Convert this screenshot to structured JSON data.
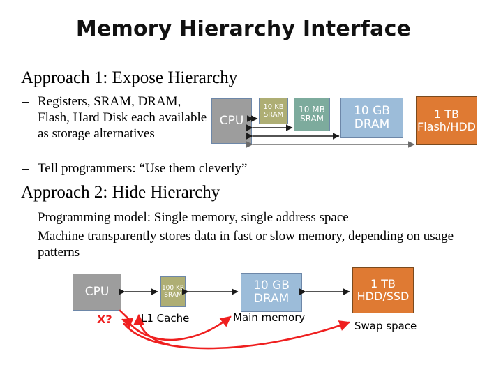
{
  "slide": {
    "title": "Memory Hierarchy Interface"
  },
  "approach1": {
    "heading": "Approach 1: Expose Hierarchy",
    "bullets": [
      {
        "dash": "–",
        "text": "Registers, SRAM, DRAM, Flash, Hard Disk each available as storage alternatives"
      },
      {
        "dash": "–",
        "text": "Tell programmers: “Use them cleverly”"
      }
    ],
    "diagram": {
      "boxes": [
        {
          "label": "CPU",
          "kind": "cpu"
        },
        {
          "label": "10 KB\nSRAM",
          "line1": "10 KB",
          "line2": "SRAM",
          "kind": "olive"
        },
        {
          "label": "10 MB\nSRAM",
          "line1": "10 MB",
          "line2": "SRAM",
          "kind": "teal"
        },
        {
          "label": "10 GB\nDRAM",
          "line1": "10 GB",
          "line2": "DRAM",
          "kind": "blue"
        },
        {
          "label": "1 TB\nFlash/HDD",
          "line1": "1 TB",
          "line2": "Flash/HDD",
          "kind": "orange"
        }
      ]
    }
  },
  "approach2": {
    "heading": "Approach 2: Hide Hierarchy",
    "bullets": [
      {
        "dash": "–",
        "text": "Programming model: Single memory, single address space"
      },
      {
        "dash": "–",
        "text": "Machine transparently stores data in fast or slow memory, depending on usage patterns"
      }
    ],
    "diagram": {
      "boxes": [
        {
          "label": "CPU",
          "kind": "cpu"
        },
        {
          "line1": "100 KB",
          "line2": "SRAM",
          "kind": "olive"
        },
        {
          "line1": "10 GB",
          "line2": "DRAM",
          "kind": "blue"
        },
        {
          "line1": "1 TB",
          "line2": "HDD/SSD",
          "kind": "orange"
        }
      ],
      "captions": [
        {
          "text": "L1 Cache"
        },
        {
          "text": "Main memory"
        },
        {
          "text": "Swap space"
        }
      ],
      "annotation": {
        "text": "X?",
        "color": "#ef1f1f"
      }
    }
  },
  "colors": {
    "cpu_fill": "#9d9d9d",
    "olive_fill": "#aeae74",
    "teal_fill": "#7dab9d",
    "blue_fill": "#9cbcd9",
    "orange_fill": "#df7a33",
    "box_border": "#6d87a8",
    "orange_border": "#7a4a1e",
    "arrow_black": "#1a1a1a",
    "arrow_gray": "#6b6b6b",
    "annotation_red": "#ef1f1f"
  }
}
